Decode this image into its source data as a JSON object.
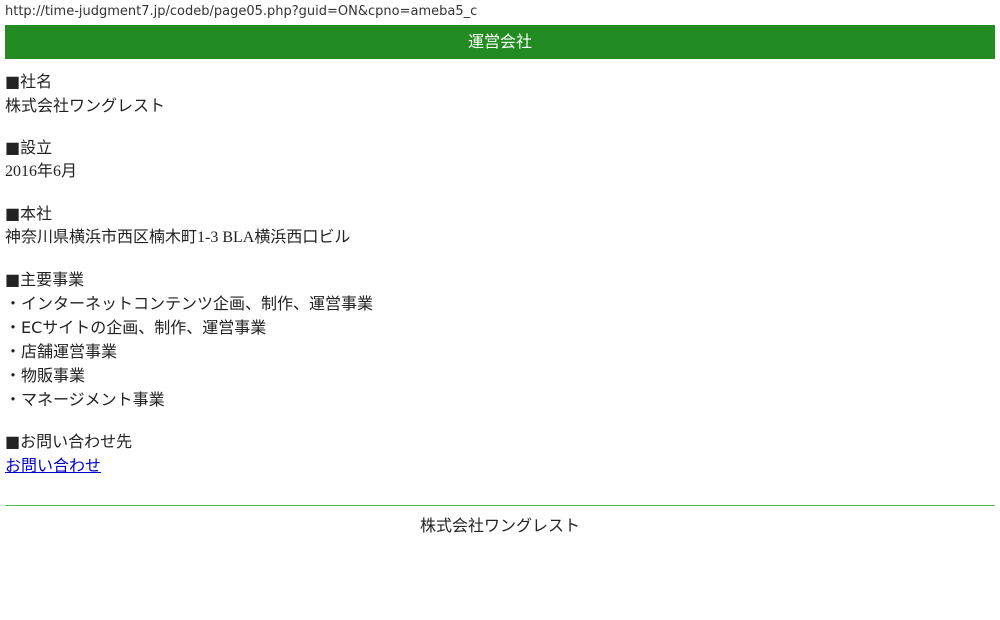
{
  "browser": {
    "url": "http://time-judgment7.jp/codeb/page05.php?guid=ON&cpno=ameba5_c"
  },
  "header": {
    "title": "運営会社"
  },
  "company": {
    "name_label": "■社名",
    "name_value": "株式会社ワングレスト",
    "founded_label": "■設立",
    "founded_value": "2016年6月",
    "hq_label": "■本社",
    "hq_value": "神奈川県横浜市西区楠木町1-3 BLA横浜西口ビル",
    "business_label": "■主要事業",
    "business_items": [
      "・インターネットコンテンツ企画、制作、運営事業",
      "・ECサイトの企画、制作、運営事業",
      "・店舗運営事業",
      "・物販事業",
      "・マネージメント事業"
    ],
    "contact_label": "■お問い合わせ先",
    "contact_link": "お問い合わせ"
  },
  "footer": {
    "text": "株式会社ワングレスト"
  },
  "colors": {
    "header_bg": "#228b22",
    "link": "#0000cc",
    "divider": "#55bb55"
  }
}
